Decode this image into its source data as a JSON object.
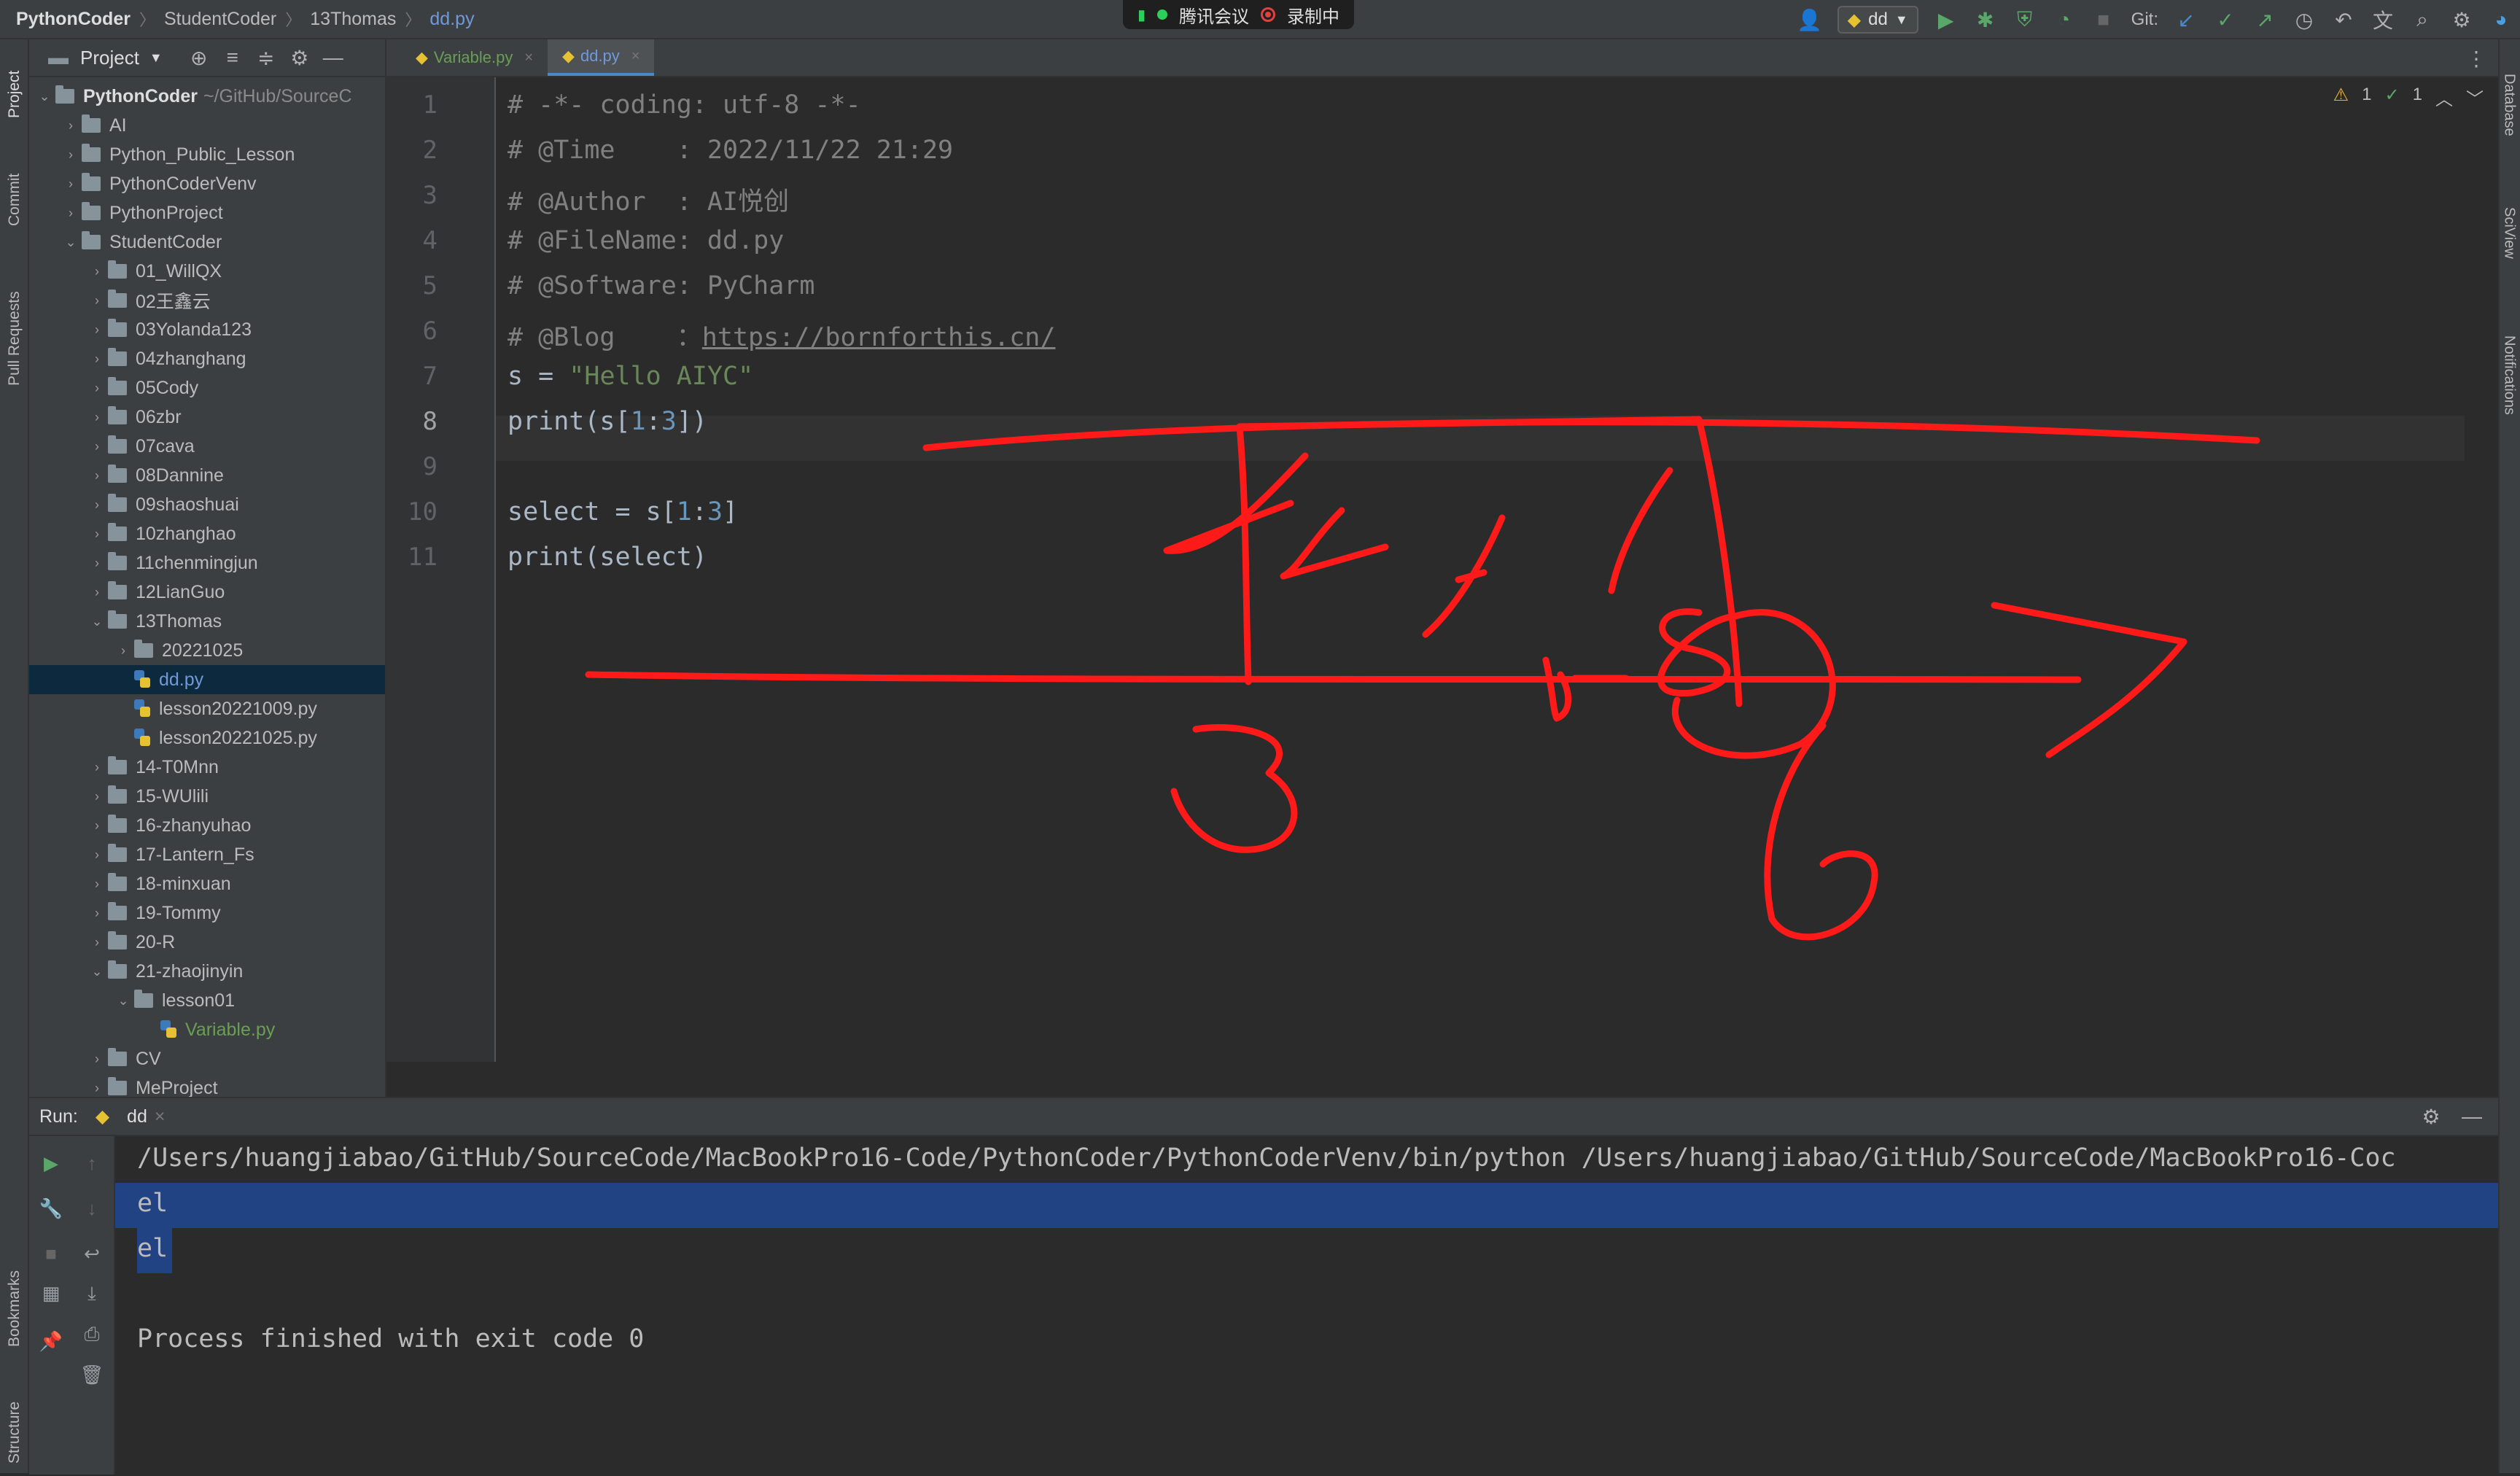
{
  "titlebar": {
    "breadcrumbs": [
      "PythonCoder",
      "StudentCoder",
      "13Thomas",
      "dd.py"
    ],
    "meeting_label": "腾讯会议",
    "recording_label": "录制中",
    "run_config": "dd",
    "git_label": "Git:"
  },
  "sidebar_tabs": {
    "left": [
      "Project",
      "Commit",
      "Pull Requests",
      "Bookmarks",
      "Structure"
    ],
    "right": [
      "Database",
      "SciView",
      "Notifications"
    ]
  },
  "project": {
    "title": "Project",
    "root": {
      "name": "PythonCoder",
      "path": "~/GitHub/SourceC"
    },
    "items": [
      {
        "label": "AI",
        "level": 1,
        "kind": "folder",
        "expanded": false
      },
      {
        "label": "Python_Public_Lesson",
        "level": 1,
        "kind": "folder",
        "expanded": false
      },
      {
        "label": "PythonCoderVenv",
        "level": 1,
        "kind": "folder",
        "expanded": false
      },
      {
        "label": "PythonProject",
        "level": 1,
        "kind": "folder",
        "expanded": false
      },
      {
        "label": "StudentCoder",
        "level": 1,
        "kind": "folder",
        "expanded": true
      },
      {
        "label": "01_WillQX",
        "level": 2,
        "kind": "folder",
        "expanded": false
      },
      {
        "label": "02王鑫云",
        "level": 2,
        "kind": "folder",
        "expanded": false
      },
      {
        "label": "03Yolanda123",
        "level": 2,
        "kind": "folder",
        "expanded": false
      },
      {
        "label": "04zhanghang",
        "level": 2,
        "kind": "folder",
        "expanded": false
      },
      {
        "label": "05Cody",
        "level": 2,
        "kind": "folder",
        "expanded": false
      },
      {
        "label": "06zbr",
        "level": 2,
        "kind": "folder",
        "expanded": false
      },
      {
        "label": "07cava",
        "level": 2,
        "kind": "folder",
        "expanded": false
      },
      {
        "label": "08Dannine",
        "level": 2,
        "kind": "folder",
        "expanded": false
      },
      {
        "label": "09shaoshuai",
        "level": 2,
        "kind": "folder",
        "expanded": false
      },
      {
        "label": "10zhanghao",
        "level": 2,
        "kind": "folder",
        "expanded": false
      },
      {
        "label": "11chenmingjun",
        "level": 2,
        "kind": "folder",
        "expanded": false
      },
      {
        "label": "12LianGuo",
        "level": 2,
        "kind": "folder",
        "expanded": false
      },
      {
        "label": "13Thomas",
        "level": 2,
        "kind": "folder",
        "expanded": true
      },
      {
        "label": "20221025",
        "level": 3,
        "kind": "folder",
        "expanded": false
      },
      {
        "label": "dd.py",
        "level": 3,
        "kind": "py",
        "selected": true
      },
      {
        "label": "lesson20221009.py",
        "level": 3,
        "kind": "py"
      },
      {
        "label": "lesson20221025.py",
        "level": 3,
        "kind": "py"
      },
      {
        "label": "14-T0Mnn",
        "level": 2,
        "kind": "folder",
        "expanded": false
      },
      {
        "label": "15-WUlili",
        "level": 2,
        "kind": "folder",
        "expanded": false
      },
      {
        "label": "16-zhanyuhao",
        "level": 2,
        "kind": "folder",
        "expanded": false
      },
      {
        "label": "17-Lantern_Fs",
        "level": 2,
        "kind": "folder",
        "expanded": false
      },
      {
        "label": "18-minxuan",
        "level": 2,
        "kind": "folder",
        "expanded": false
      },
      {
        "label": "19-Tommy",
        "level": 2,
        "kind": "folder",
        "expanded": false
      },
      {
        "label": "20-R",
        "level": 2,
        "kind": "folder",
        "expanded": false
      },
      {
        "label": "21-zhaojinyin",
        "level": 2,
        "kind": "folder",
        "expanded": true
      },
      {
        "label": "lesson01",
        "level": 3,
        "kind": "folder",
        "expanded": true
      },
      {
        "label": "Variable.py",
        "level": 4,
        "kind": "py",
        "green": true
      },
      {
        "label": "CV",
        "level": 2,
        "kind": "folder",
        "expanded": false
      },
      {
        "label": "MeProject",
        "level": 2,
        "kind": "folder",
        "expanded": false
      }
    ]
  },
  "editor": {
    "tabs": [
      {
        "label": "Variable.py",
        "active": false
      },
      {
        "label": "dd.py",
        "active": true
      }
    ],
    "inspections": {
      "warnings": "1",
      "ok": "1"
    },
    "lines": [
      {
        "n": "1",
        "parts": [
          {
            "t": "# -*- coding: utf-8 -*-",
            "c": "cm"
          }
        ]
      },
      {
        "n": "2",
        "parts": [
          {
            "t": "# @Time    : 2022/11/22 21:29",
            "c": "cm"
          }
        ]
      },
      {
        "n": "3",
        "parts": [
          {
            "t": "# @Author  : AI悦创",
            "c": "cm"
          }
        ]
      },
      {
        "n": "4",
        "parts": [
          {
            "t": "# @FileName: dd.py",
            "c": "cm"
          }
        ]
      },
      {
        "n": "5",
        "parts": [
          {
            "t": "# @Software: PyCharm",
            "c": "cm"
          }
        ]
      },
      {
        "n": "6",
        "parts": [
          {
            "t": "# @Blog    ：",
            "c": "cm"
          },
          {
            "t": "https://bornforthis.cn/",
            "c": "lnk"
          }
        ]
      },
      {
        "n": "7",
        "parts": [
          {
            "t": "s = ",
            "c": ""
          },
          {
            "t": "\"Hello AIYC\"",
            "c": "str"
          }
        ]
      },
      {
        "n": "8",
        "parts": [
          {
            "t": "print(s[",
            "c": ""
          },
          {
            "t": "1",
            "c": "num"
          },
          {
            "t": ":",
            "c": ""
          },
          {
            "t": "3",
            "c": "num"
          },
          {
            "t": "])",
            "c": ""
          }
        ]
      },
      {
        "n": "9",
        "parts": []
      },
      {
        "n": "10",
        "parts": [
          {
            "t": "select = s[",
            "c": ""
          },
          {
            "t": "1",
            "c": "num"
          },
          {
            "t": ":",
            "c": ""
          },
          {
            "t": "3",
            "c": "num"
          },
          {
            "t": "]",
            "c": ""
          }
        ]
      },
      {
        "n": "11",
        "parts": [
          {
            "t": "print(select)",
            "c": ""
          }
        ]
      }
    ]
  },
  "run": {
    "label": "Run:",
    "tab": "dd",
    "command": "/Users/huangjiabao/GitHub/SourceCode/MacBookPro16-Code/PythonCoder/PythonCoderVenv/bin/python /Users/huangjiabao/GitHub/SourceCode/MacBookPro16-Coc",
    "output": [
      "el",
      "el"
    ],
    "exit": "Process finished with exit code 0"
  },
  "annotation_colors": {
    "ink": "#ff1a1a"
  }
}
